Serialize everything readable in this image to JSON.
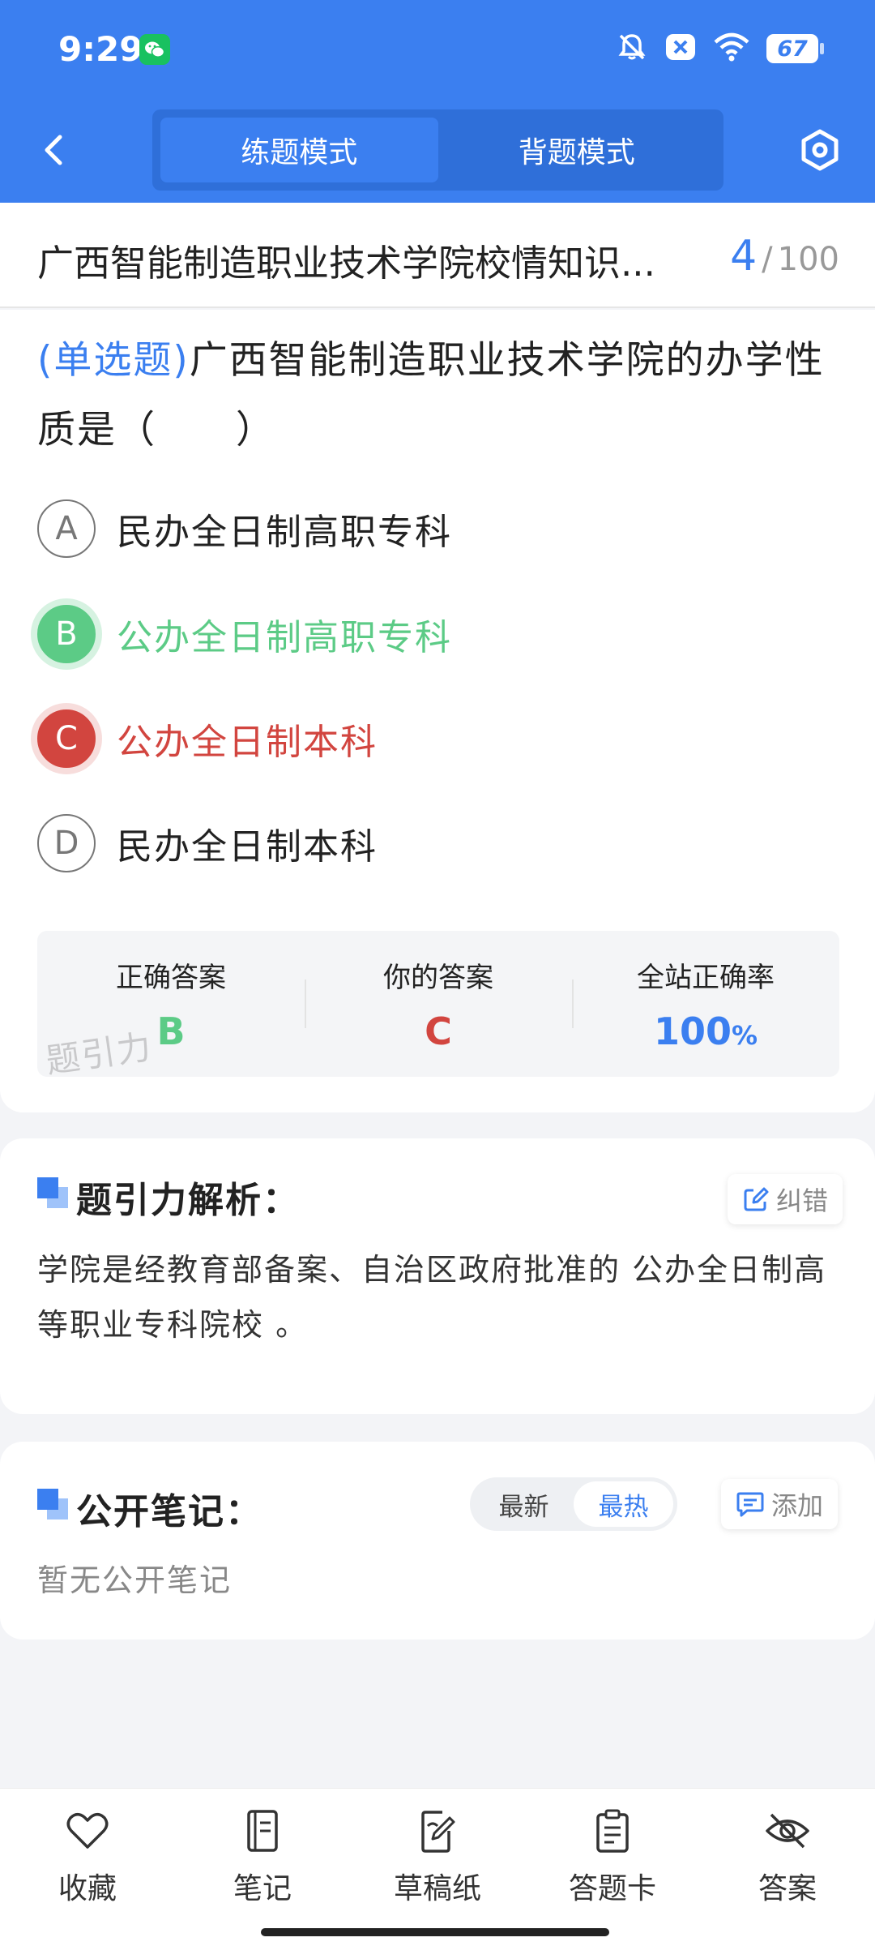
{
  "status_bar": {
    "time": "9:29",
    "battery": "67",
    "icons": [
      "wechat-icon",
      "bell-off-icon",
      "x-badge-icon",
      "wifi-icon",
      "battery-icon"
    ]
  },
  "nav": {
    "tabs": [
      {
        "label": "练题模式",
        "active": true
      },
      {
        "label": "背题模式",
        "active": false
      }
    ],
    "back_icon": "chevron-left-icon",
    "settings_icon": "hexagon-settings-icon"
  },
  "title_bar": {
    "title": "广西智能制造职业技术学院校情知识...",
    "current": "4",
    "separator": "/",
    "total": "100"
  },
  "question": {
    "type_label": "(单选题)",
    "text": "广西智能制造职业技术学院的办学性质是（　　）",
    "options": [
      {
        "letter": "A",
        "text": "民办全日制高职专科",
        "state": "normal"
      },
      {
        "letter": "B",
        "text": "公办全日制高职专科",
        "state": "correct"
      },
      {
        "letter": "C",
        "text": "公办全日制本科",
        "state": "wrong"
      },
      {
        "letter": "D",
        "text": "民办全日制本科",
        "state": "normal"
      }
    ]
  },
  "answer_summary": {
    "correct_label": "正确答案",
    "correct_value": "B",
    "yours_label": "你的答案",
    "yours_value": "C",
    "rate_label": "全站正确率",
    "rate_value": "100",
    "rate_unit": "%",
    "watermark": "题引力"
  },
  "analysis": {
    "title": "题引力解析：",
    "report_label": "纠错",
    "text": "学院是经教育部备案、自治区政府批准的 公办全日制高等职业专科院校 。"
  },
  "notes": {
    "title": "公开笔记：",
    "sort_options": [
      {
        "label": "最新",
        "active": false
      },
      {
        "label": "最热",
        "active": true
      }
    ],
    "add_label": "添加",
    "empty_text": "暂无公开笔记"
  },
  "bottom_tabs": [
    {
      "label": "收藏",
      "icon": "heart-icon"
    },
    {
      "label": "笔记",
      "icon": "notebook-icon"
    },
    {
      "label": "草稿纸",
      "icon": "draft-paper-icon"
    },
    {
      "label": "答题卡",
      "icon": "answer-sheet-icon"
    },
    {
      "label": "答案",
      "icon": "eye-off-icon"
    }
  ],
  "colors": {
    "primary": "#3b7ff0",
    "correct": "#5ccb86",
    "wrong": "#d2453f"
  }
}
